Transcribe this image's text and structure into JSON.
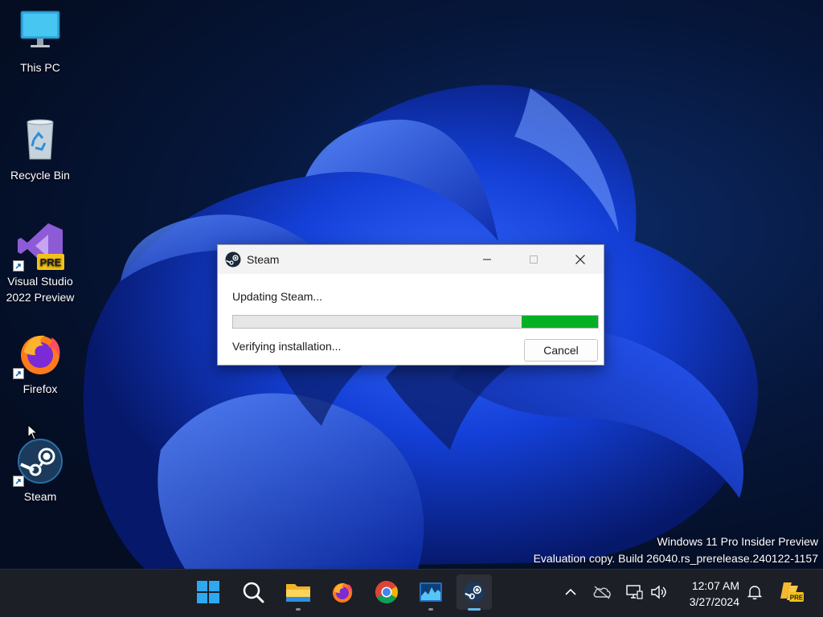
{
  "desktop": {
    "icons": [
      {
        "label": "This PC"
      },
      {
        "label": "Recycle Bin"
      },
      {
        "label": "Visual Studio 2022 Preview",
        "line1": "Visual Studio",
        "line2": "2022 Preview",
        "badge": "PRE"
      },
      {
        "label": "Firefox"
      },
      {
        "label": "Steam"
      }
    ],
    "watermark": {
      "line1": "Windows 11 Pro Insider Preview",
      "line2": "Evaluation copy. Build 26040.rs_prerelease.240122-1157"
    }
  },
  "dialog": {
    "title": "Steam",
    "status_primary": "Updating Steam...",
    "status_secondary": "Verifying installation...",
    "progress_fraction": 0.21,
    "cancel_label": "Cancel",
    "colors": {
      "progress": "#06b025",
      "track": "#e6e6e6"
    }
  },
  "taskbar": {
    "apps": [
      {
        "name": "start",
        "icon": "windows-logo-icon"
      },
      {
        "name": "search",
        "icon": "search-icon"
      },
      {
        "name": "file-explorer",
        "icon": "folder-icon",
        "running": true
      },
      {
        "name": "firefox",
        "icon": "firefox-icon"
      },
      {
        "name": "chrome",
        "icon": "chrome-icon"
      },
      {
        "name": "task-manager",
        "icon": "task-manager-icon",
        "running": true
      },
      {
        "name": "steam",
        "icon": "steam-icon",
        "active": true
      }
    ],
    "clock": {
      "time": "12:07 AM",
      "date": "3/27/2024"
    },
    "tray_icons": [
      "chevron-up-icon",
      "cloud-offline-icon",
      "network-icon",
      "volume-icon",
      "notification-bell-icon",
      "copilot-pre-icon"
    ],
    "copilot_badge": "PRE"
  }
}
